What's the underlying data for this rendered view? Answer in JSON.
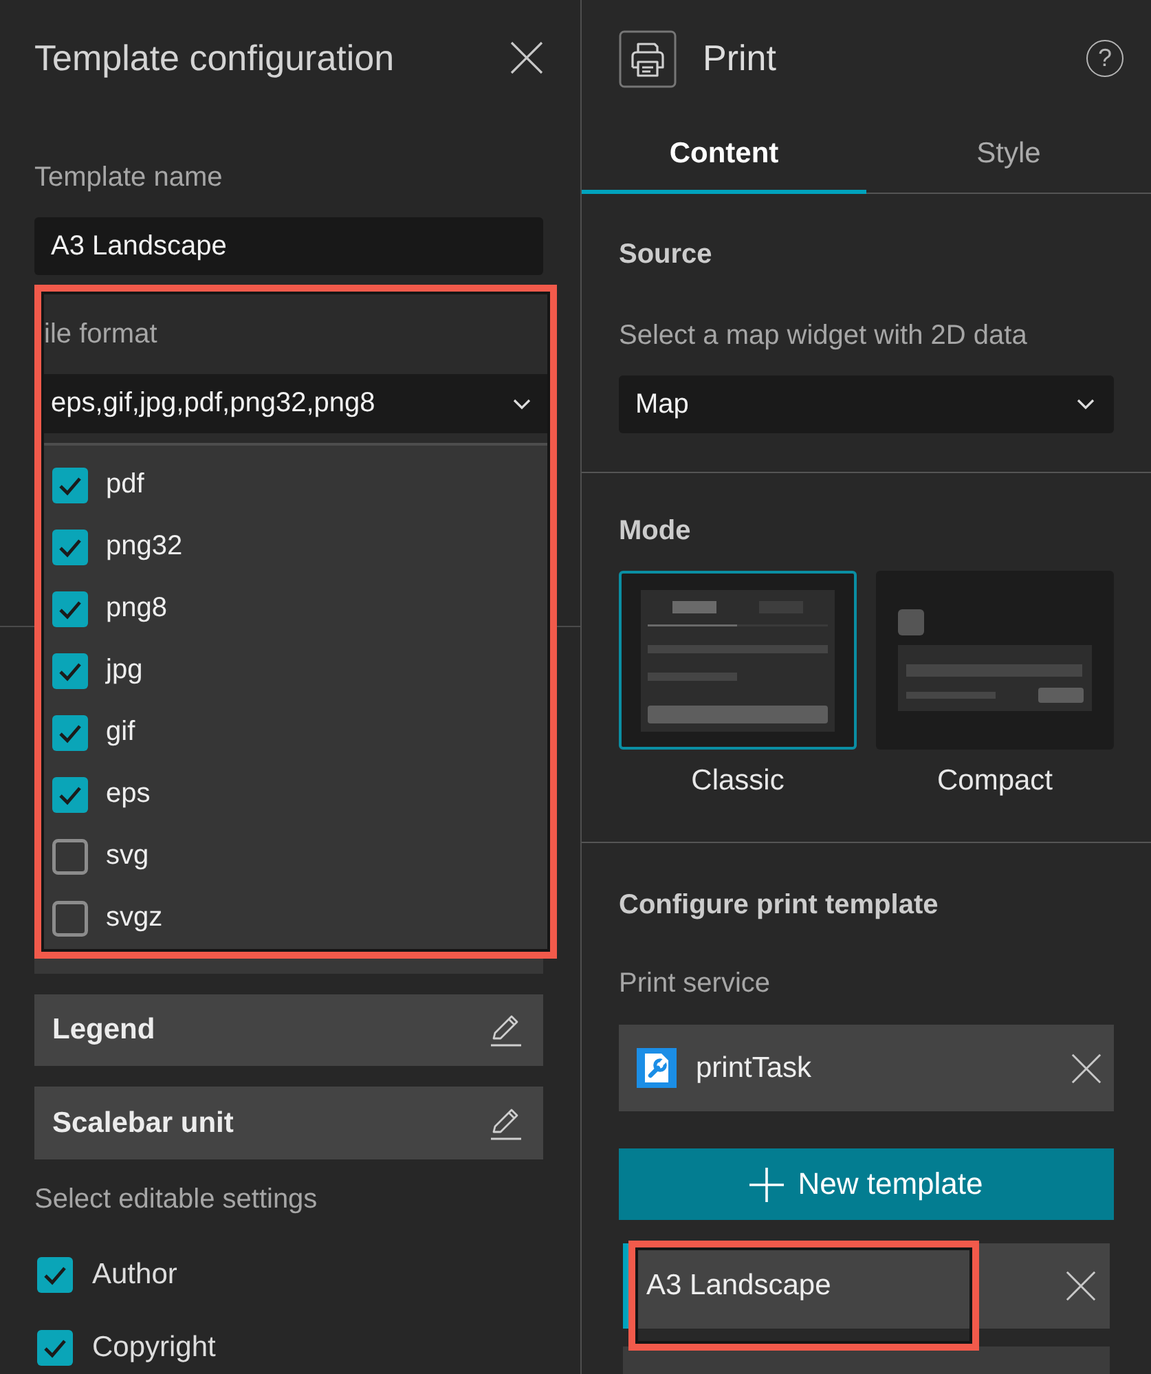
{
  "template_config": {
    "title": "Template configuration",
    "template_name": {
      "label": "Template name",
      "value": "A3 Landscape"
    },
    "file_format": {
      "label": "ile format",
      "value": "eps,gif,jpg,pdf,png32,png8",
      "highlighted": true,
      "expanded": true,
      "options": [
        {
          "label": "pdf",
          "checked": true
        },
        {
          "label": "png32",
          "checked": true
        },
        {
          "label": "png8",
          "checked": true
        },
        {
          "label": "jpg",
          "checked": true
        },
        {
          "label": "gif",
          "checked": true
        },
        {
          "label": "eps",
          "checked": true
        },
        {
          "label": "svg",
          "checked": false
        },
        {
          "label": "svgz",
          "checked": false
        }
      ]
    },
    "settings": [
      {
        "label": "Legend"
      },
      {
        "label": "Scalebar unit"
      }
    ],
    "editable_settings": {
      "label": "Select editable settings",
      "options": [
        {
          "label": "Author",
          "checked": true
        },
        {
          "label": "Copyright",
          "checked": true
        }
      ]
    }
  },
  "print_panel": {
    "title": "Print",
    "help": "?",
    "tabs": [
      {
        "label": "Content",
        "selected": true
      },
      {
        "label": "Style",
        "selected": false
      }
    ],
    "source": {
      "heading": "Source",
      "label": "Select a map widget with 2D data",
      "value": "Map"
    },
    "mode": {
      "heading": "Mode",
      "options": [
        {
          "kind": "classic",
          "label": "Classic",
          "selected": true
        },
        {
          "kind": "compact",
          "label": "Compact",
          "selected": false
        }
      ]
    },
    "configure": {
      "heading": "Configure print template",
      "service_label": "Print service",
      "service": "printTask",
      "new_button": "New template",
      "templates": [
        {
          "label": "A3 Landscape",
          "selected": true,
          "highlighted": true
        }
      ]
    }
  }
}
